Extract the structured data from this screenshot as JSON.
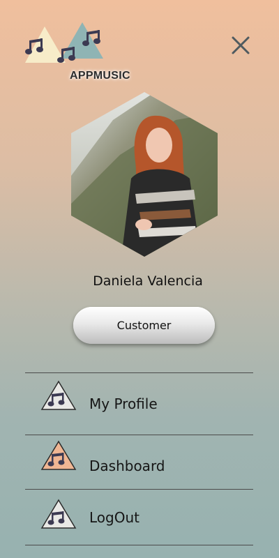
{
  "app": {
    "logo_text": "APPMUSIC"
  },
  "profile": {
    "name": "Daniela Valencia",
    "role_button": "Customer"
  },
  "menu": {
    "items": [
      {
        "label": "My Profile",
        "icon": "music-triangle-icon",
        "accent": "#e9e9e6"
      },
      {
        "label": "Dashboard",
        "icon": "music-triangle-icon",
        "accent": "#f0b693"
      },
      {
        "label": "LogOut",
        "icon": "music-triangle-icon",
        "accent": "#e9e9e6"
      }
    ]
  },
  "colors": {
    "gradient_top": "#f0bf9d",
    "gradient_bottom": "#97b2b0",
    "logo_cream": "#f7ecc9",
    "logo_teal": "#8fb4b4",
    "note": "#3c3a52"
  }
}
